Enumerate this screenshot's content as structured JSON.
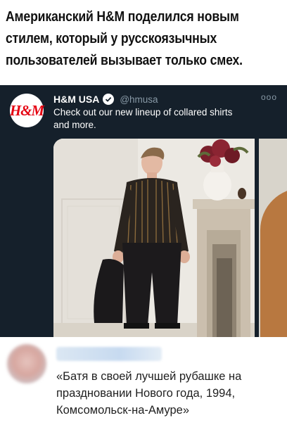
{
  "headline": {
    "line1": "Американский H&M поделился новым",
    "line2": "стилем, который у русскоязычных",
    "line3": "пользователей вызывает только смех."
  },
  "tweet": {
    "logo_text": "H&M",
    "author_name": "H&M USA",
    "handle": "@hmusa",
    "more_label": "ooo",
    "text_line1": "Check out our new lineup of collared shirts",
    "text_line2": "and more.",
    "colors": {
      "background": "#15202b",
      "brand_red": "#e50010",
      "secondary_text": "#8899a6"
    }
  },
  "reply": {
    "line1": "«Батя в своей лучшей рубашке на",
    "line2": "праздновании Нового года, 1994,",
    "line3": "Комсомольск-на-Амуре»"
  }
}
